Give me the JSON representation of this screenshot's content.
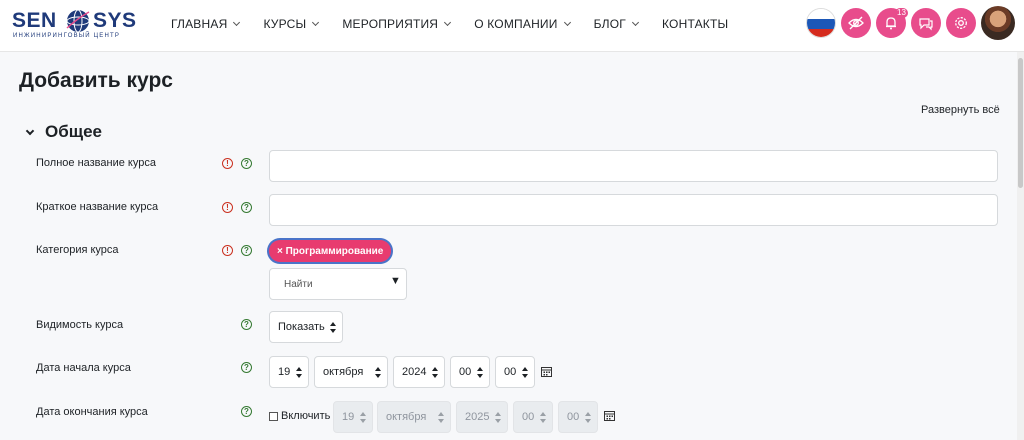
{
  "brand": {
    "left": "SEN",
    "right": "SYS",
    "tagline": "ИНЖИНИРИНГОВЫЙ ЦЕНТР"
  },
  "nav": [
    {
      "label": "ГЛАВНАЯ",
      "dropdown": true
    },
    {
      "label": "КУРСЫ",
      "dropdown": true
    },
    {
      "label": "МЕРОПРИЯТИЯ",
      "dropdown": true
    },
    {
      "label": "О КОМПАНИИ",
      "dropdown": true
    },
    {
      "label": "БЛОГ",
      "dropdown": true
    },
    {
      "label": "КОНТАКТЫ",
      "dropdown": false
    }
  ],
  "header_icons": {
    "language_flag": "russia-flag-icon",
    "notification_count": "13",
    "icons": [
      "eye-slash-icon",
      "bell-icon",
      "chat-icon",
      "gear-icon"
    ],
    "accent": "#e84c8c"
  },
  "page": {
    "title": "Добавить курс",
    "expand_all": "Развернуть всё"
  },
  "section": {
    "title": "Общее"
  },
  "form": {
    "fullname": {
      "label": "Полное название курса",
      "value": ""
    },
    "shortname": {
      "label": "Краткое название курса",
      "value": ""
    },
    "category": {
      "label": "Категория курса",
      "selected_tag": "× Программирование",
      "search_placeholder": "Найти"
    },
    "visibility": {
      "label": "Видимость курса",
      "value": "Показать"
    },
    "start_date": {
      "label": "Дата начала курса",
      "day": "19",
      "month": "октября",
      "year": "2024",
      "hour": "00",
      "minute": "00"
    },
    "end_date": {
      "label": "Дата окончания курса",
      "enable_label": "Включить",
      "enabled": false,
      "day": "19",
      "month": "октября",
      "year": "2025",
      "hour": "00",
      "minute": "00"
    }
  },
  "colors": {
    "tag_bg": "#e83b6f",
    "required": "#ca3120",
    "help": "#357a32",
    "brand": "#1f3a7a"
  }
}
